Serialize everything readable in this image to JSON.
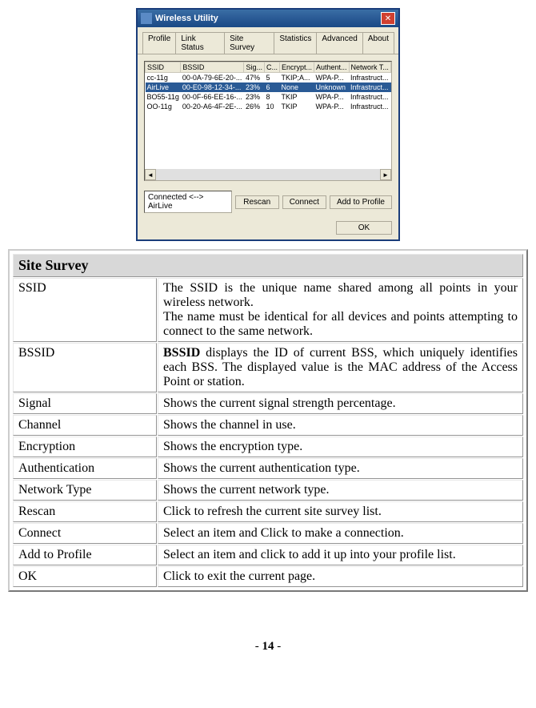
{
  "window": {
    "title": "Wireless Utility",
    "tabs": [
      "Profile",
      "Link Status",
      "Site Survey",
      "Statistics",
      "Advanced",
      "About"
    ],
    "activeTab": "Site Survey",
    "headers": [
      "SSID",
      "BSSID",
      "Sig...",
      "C...",
      "Encrypt...",
      "Authent...",
      "Network T..."
    ],
    "rows": [
      {
        "ssid": "cc-11g",
        "bssid": "00-0A-79-6E-20-...",
        "sig": "47%",
        "ch": "5",
        "enc": "TKIP;A...",
        "auth": "WPA-P...",
        "nt": "Infrastruct..."
      },
      {
        "ssid": "AirLive",
        "bssid": "00-E0-98-12-34-...",
        "sig": "23%",
        "ch": "6",
        "enc": "None",
        "auth": "Unknown",
        "nt": "Infrastruct...",
        "selected": true
      },
      {
        "ssid": "BO55-11g",
        "bssid": "00-0F-66-EE-16-...",
        "sig": "23%",
        "ch": "8",
        "enc": "TKIP",
        "auth": "WPA-P...",
        "nt": "Infrastruct..."
      },
      {
        "ssid": "OO-11g",
        "bssid": "00-20-A6-4F-2E-...",
        "sig": "26%",
        "ch": "10",
        "enc": "TKIP",
        "auth": "WPA-P...",
        "nt": "Infrastruct..."
      }
    ],
    "status": "Connected <--> AirLive",
    "buttons": {
      "rescan": "Rescan",
      "connect": "Connect",
      "addprofile": "Add to Profile",
      "ok": "OK"
    }
  },
  "desc": {
    "title": "Site Survey",
    "rows": [
      {
        "term": "SSID",
        "def": "The SSID is the unique name shared among all points in your wireless network.\nThe name must be identical for all devices and points attempting to connect to the same network."
      },
      {
        "term": "BSSID",
        "def": "<b>BSSID</b> displays the ID of current BSS, which uniquely identifies each BSS. The displayed value is the MAC address of the Access Point or station."
      },
      {
        "term": "Signal",
        "def": "Shows the current signal strength percentage."
      },
      {
        "term": "Channel",
        "def": "Shows the channel in use."
      },
      {
        "term": "Encryption",
        "def": "Shows the encryption type."
      },
      {
        "term": "Authentication",
        "def": "Shows the current authentication type."
      },
      {
        "term": "Network Type",
        "def": "Shows the current network type."
      },
      {
        "term": "Rescan",
        "def": "Click to refresh the current site survey list."
      },
      {
        "term": "Connect",
        "def": "Select an item and Click to make a connection."
      },
      {
        "term": "Add to Profile",
        "def": "Select an item and click to add it up into your profile list."
      },
      {
        "term": "OK",
        "def": "Click to exit the current page."
      }
    ]
  },
  "pageNumber": "14"
}
